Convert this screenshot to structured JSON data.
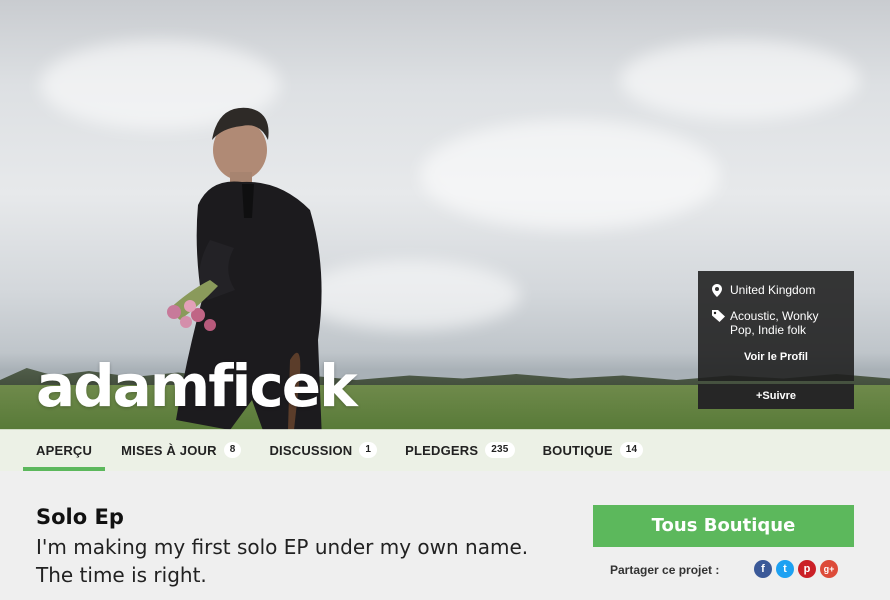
{
  "artist": {
    "name": "adamficek"
  },
  "profile": {
    "location": "United Kingdom",
    "genres": "Acoustic, Wonky Pop, Indie folk",
    "view_profile": "Voir le Profil",
    "follow": "+Suivre",
    "location_icon": "map-pin-icon",
    "tag_icon": "tag-icon"
  },
  "nav": {
    "tabs": [
      {
        "label": "APERÇU",
        "count": null,
        "active": true
      },
      {
        "label": "MISES À JOUR",
        "count": "8"
      },
      {
        "label": "DISCUSSION",
        "count": "1"
      },
      {
        "label": "PLEDGERS",
        "count": "235"
      },
      {
        "label": "BOUTIQUE",
        "count": "14"
      }
    ]
  },
  "project": {
    "title": "Solo Ep",
    "description": "I'm making my first solo EP under my own name. The time is right.",
    "shop_button": "Tous Boutique",
    "share_label": "Partager ce projet :",
    "share_icons": [
      {
        "name": "facebook-icon",
        "glyph": "f",
        "color": "#3b5998"
      },
      {
        "name": "twitter-icon",
        "glyph": "t",
        "color": "#1da1f2"
      },
      {
        "name": "pinterest-icon",
        "glyph": "p",
        "color": "#cb2027"
      },
      {
        "name": "google-plus-icon",
        "glyph": "g+",
        "color": "#dd4b39"
      }
    ]
  },
  "colors": {
    "accent": "#5cb85c",
    "overlay_dark": "#1e1e1e"
  }
}
